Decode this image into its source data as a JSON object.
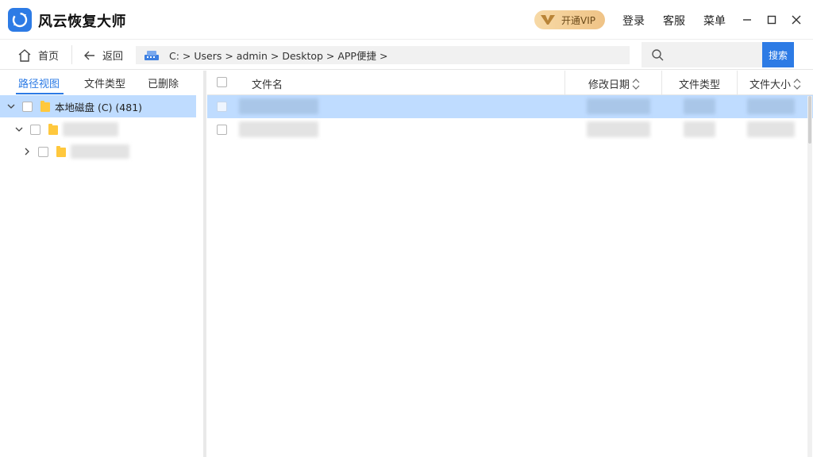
{
  "app": {
    "title": "风云恢复大师"
  },
  "titlebar": {
    "vip_label": "开通VIP",
    "login": "登录",
    "service": "客服",
    "menu": "菜单"
  },
  "nav": {
    "home": "首页",
    "back": "返回",
    "path": "C:  >  Users  >  admin  >  Desktop  >  APP便捷  >",
    "search_button": "搜索",
    "search_placeholder": ""
  },
  "left_tabs": [
    {
      "label": "路径视图",
      "active": true
    },
    {
      "label": "文件类型",
      "active": false
    },
    {
      "label": "已删除",
      "active": false
    }
  ],
  "tree": {
    "root": {
      "label": "本地磁盘 (C) (481)"
    }
  },
  "table": {
    "columns": {
      "name": "文件名",
      "date": "修改日期",
      "type": "文件类型",
      "size": "文件大小"
    }
  },
  "colors": {
    "accent": "#2d7be5",
    "selection": "#bfdcff",
    "vip_bg": "#f2cd91",
    "folder": "#ffc83d"
  },
  "icons": [
    "app-logo-icon",
    "vip-icon",
    "minimize-icon",
    "maximize-icon",
    "close-icon",
    "home-icon",
    "back-arrow-icon",
    "drive-icon",
    "search-icon",
    "chevron-down-icon",
    "chevron-right-icon",
    "folder-icon",
    "sort-icon"
  ]
}
